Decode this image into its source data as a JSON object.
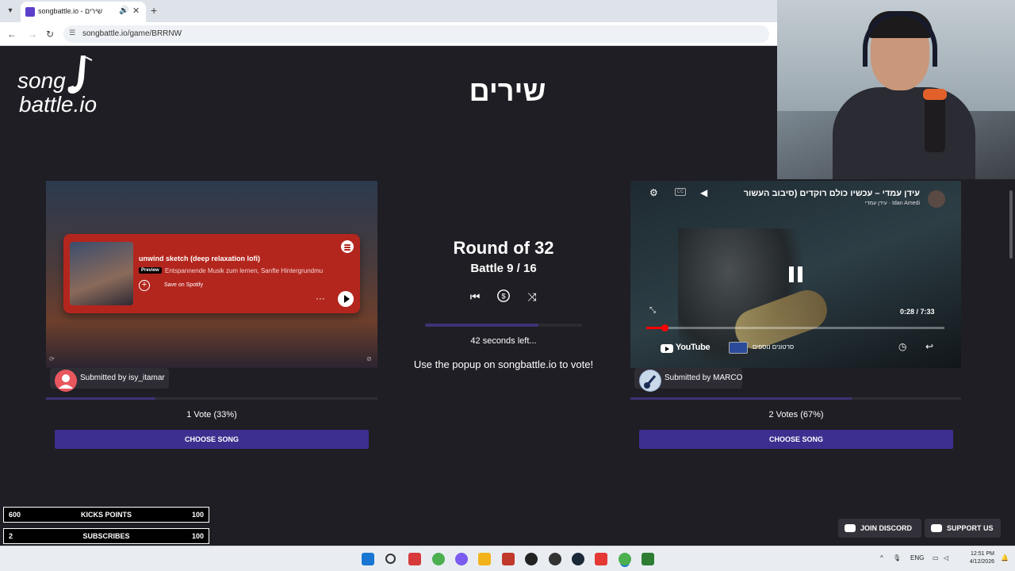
{
  "browser": {
    "tab_title": "songbattle.io - שירים",
    "url": "songbattle.io/game/BRRNW"
  },
  "page": {
    "logo_line1": "song",
    "logo_line2": "battle.io",
    "title": "שירים"
  },
  "left_song": {
    "spotify_title": "unwind sketch (deep relaxation lofi)",
    "spotify_badge": "Preview",
    "spotify_subtitle": "Entspannende Musik zum lernen, Sanfte Hintergrundmu",
    "spotify_save": "Save on Spotify",
    "spotify_more": "···",
    "submitted_by": "Submitted by isy_itamar",
    "votes": "1 Vote (33%)",
    "vote_fraction": 0.33,
    "choose_label": "CHOOSE SONG"
  },
  "right_song": {
    "video_title": "עידן עמדי – עכשיו כולם רוקדים (סיבוב העשור",
    "channel": "עידן עמדי · Idan Amedi",
    "time": "0:28 / 7:33",
    "progress_fraction": 0.062,
    "youtube_label": "YouTube",
    "related_label": "סרטונים נוספים",
    "submitted_by": "Submitted by MARCO",
    "votes": "2 Votes (67%)",
    "vote_fraction": 0.67,
    "choose_label": "CHOOSE SONG"
  },
  "battle": {
    "round": "Round of 32",
    "battle": "Battle 9 / 16",
    "seconds_left": "42 seconds left...",
    "timer_fraction": 0.72,
    "popup_message": "Use the popup on songbattle.io to vote!"
  },
  "overlay": {
    "stats": [
      {
        "left": "600",
        "label": "KICKS POINTS",
        "right": "100"
      },
      {
        "left": "2",
        "label": "SUBSCRIBES",
        "right": "100"
      }
    ]
  },
  "footer": {
    "join": "JOIN DISCORD",
    "support": "SUPPORT US"
  },
  "taskbar": {
    "lang": "ENG",
    "time": "12:51 PM",
    "date": "4/12/2026"
  },
  "colors": {
    "background": "#1f1e24",
    "accent": "#3c2f8f",
    "spotify_red": "#b3261e",
    "youtube_red": "#ff0000"
  }
}
